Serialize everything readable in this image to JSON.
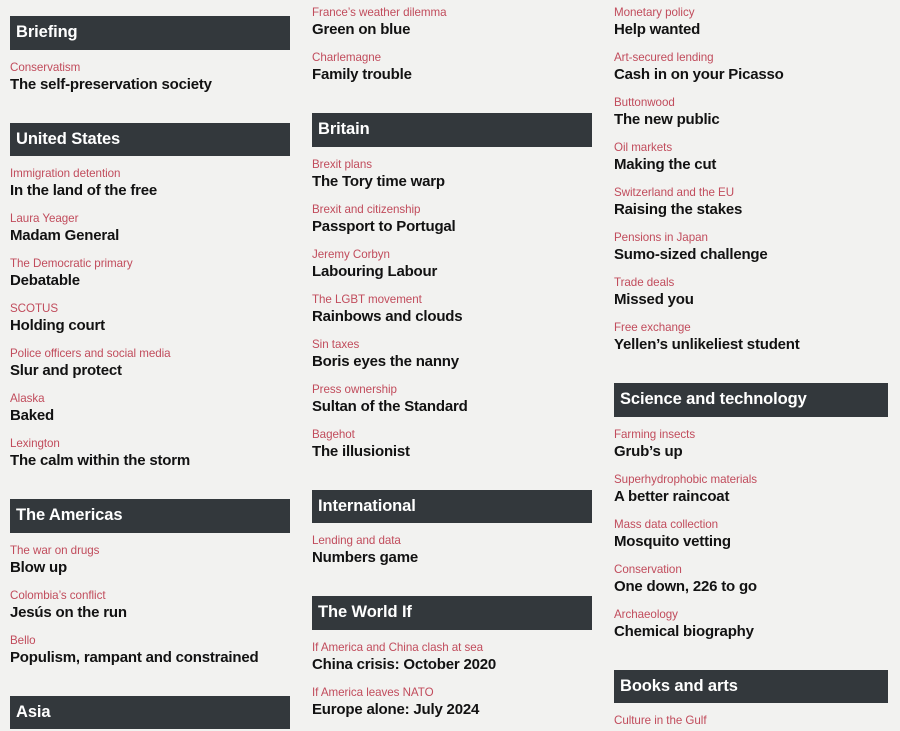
{
  "theme": {
    "background": "#f2f2f0",
    "header_bar_bg": "#33383c",
    "header_bar_text": "#ffffff",
    "kicker_color": "#c14c5c",
    "headline_color": "#121212"
  },
  "columns": [
    {
      "id": "column-left",
      "sections": [
        {
          "title": "Briefing",
          "articles": [
            {
              "kicker": "Conservatism",
              "headline": "The self-preservation society"
            }
          ]
        },
        {
          "title": "United States",
          "articles": [
            {
              "kicker": "Immigration detention",
              "headline": "In the land of the free"
            },
            {
              "kicker": "Laura Yeager",
              "headline": "Madam General"
            },
            {
              "kicker": "The Democratic primary",
              "headline": "Debatable"
            },
            {
              "kicker": "SCOTUS",
              "headline": "Holding court"
            },
            {
              "kicker": "Police officers and social media",
              "headline": "Slur and protect"
            },
            {
              "kicker": "Alaska",
              "headline": "Baked"
            },
            {
              "kicker": "Lexington",
              "headline": "The calm within the storm"
            }
          ]
        },
        {
          "title": "The Americas",
          "articles": [
            {
              "kicker": "The war on drugs",
              "headline": "Blow up"
            },
            {
              "kicker": "Colombia’s conflict",
              "headline": "Jesús on the run"
            },
            {
              "kicker": "Bello",
              "headline": "Populism, rampant and constrained"
            }
          ]
        },
        {
          "title": "Asia",
          "articles": []
        }
      ]
    },
    {
      "id": "column-middle",
      "sections": [
        {
          "title": null,
          "articles": [
            {
              "kicker": "France’s weather dilemma",
              "headline": "Green on blue"
            },
            {
              "kicker": "Charlemagne",
              "headline": "Family trouble"
            }
          ]
        },
        {
          "title": "Britain",
          "articles": [
            {
              "kicker": "Brexit plans",
              "headline": "The Tory time warp"
            },
            {
              "kicker": "Brexit and citizenship",
              "headline": "Passport to Portugal"
            },
            {
              "kicker": "Jeremy Corbyn",
              "headline": "Labouring Labour"
            },
            {
              "kicker": "The LGBT movement",
              "headline": "Rainbows and clouds"
            },
            {
              "kicker": "Sin taxes",
              "headline": "Boris eyes the nanny"
            },
            {
              "kicker": "Press ownership",
              "headline": "Sultan of the Standard"
            },
            {
              "kicker": "Bagehot",
              "headline": "The illusionist"
            }
          ]
        },
        {
          "title": "International",
          "articles": [
            {
              "kicker": "Lending and data",
              "headline": "Numbers game"
            }
          ]
        },
        {
          "title": "The World If",
          "articles": [
            {
              "kicker": "If America and China clash at sea",
              "headline": "China crisis: October 2020"
            },
            {
              "kicker": "If America leaves NATO",
              "headline": "Europe alone: July 2024"
            }
          ]
        }
      ]
    },
    {
      "id": "column-right",
      "sections": [
        {
          "title": null,
          "articles": [
            {
              "kicker": "Monetary policy",
              "headline": "Help wanted"
            },
            {
              "kicker": "Art-secured lending",
              "headline": "Cash in on your Picasso"
            },
            {
              "kicker": "Buttonwood",
              "headline": "The new public"
            },
            {
              "kicker": "Oil markets",
              "headline": "Making the cut"
            },
            {
              "kicker": "Switzerland and the EU",
              "headline": "Raising the stakes"
            },
            {
              "kicker": "Pensions in Japan",
              "headline": "Sumo-sized challenge"
            },
            {
              "kicker": "Trade deals",
              "headline": "Missed you"
            },
            {
              "kicker": "Free exchange",
              "headline": "Yellen’s unlikeliest student"
            }
          ]
        },
        {
          "title": "Science and technology",
          "articles": [
            {
              "kicker": "Farming insects",
              "headline": "Grub’s up"
            },
            {
              "kicker": "Superhydrophobic materials",
              "headline": "A better raincoat"
            },
            {
              "kicker": "Mass data collection",
              "headline": "Mosquito vetting"
            },
            {
              "kicker": "Conservation",
              "headline": "One down, 226 to go"
            },
            {
              "kicker": "Archaeology",
              "headline": "Chemical biography"
            }
          ]
        },
        {
          "title": "Books and arts",
          "articles": [
            {
              "kicker": "Culture in the Gulf",
              "headline": ""
            }
          ]
        }
      ]
    }
  ]
}
